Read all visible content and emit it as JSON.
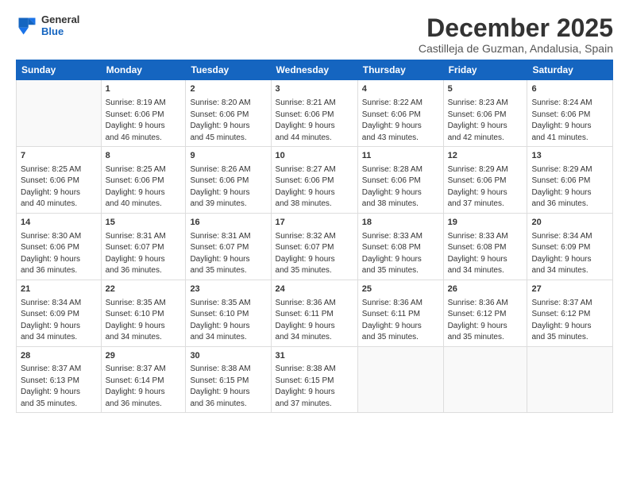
{
  "logo": {
    "line1": "General",
    "line2": "Blue"
  },
  "title": "December 2025",
  "location": "Castilleja de Guzman, Andalusia, Spain",
  "weekdays": [
    "Sunday",
    "Monday",
    "Tuesday",
    "Wednesday",
    "Thursday",
    "Friday",
    "Saturday"
  ],
  "weeks": [
    [
      {
        "day": "",
        "info": ""
      },
      {
        "day": "1",
        "info": "Sunrise: 8:19 AM\nSunset: 6:06 PM\nDaylight: 9 hours\nand 46 minutes."
      },
      {
        "day": "2",
        "info": "Sunrise: 8:20 AM\nSunset: 6:06 PM\nDaylight: 9 hours\nand 45 minutes."
      },
      {
        "day": "3",
        "info": "Sunrise: 8:21 AM\nSunset: 6:06 PM\nDaylight: 9 hours\nand 44 minutes."
      },
      {
        "day": "4",
        "info": "Sunrise: 8:22 AM\nSunset: 6:06 PM\nDaylight: 9 hours\nand 43 minutes."
      },
      {
        "day": "5",
        "info": "Sunrise: 8:23 AM\nSunset: 6:06 PM\nDaylight: 9 hours\nand 42 minutes."
      },
      {
        "day": "6",
        "info": "Sunrise: 8:24 AM\nSunset: 6:06 PM\nDaylight: 9 hours\nand 41 minutes."
      }
    ],
    [
      {
        "day": "7",
        "info": "Sunrise: 8:25 AM\nSunset: 6:06 PM\nDaylight: 9 hours\nand 40 minutes."
      },
      {
        "day": "8",
        "info": "Sunrise: 8:25 AM\nSunset: 6:06 PM\nDaylight: 9 hours\nand 40 minutes."
      },
      {
        "day": "9",
        "info": "Sunrise: 8:26 AM\nSunset: 6:06 PM\nDaylight: 9 hours\nand 39 minutes."
      },
      {
        "day": "10",
        "info": "Sunrise: 8:27 AM\nSunset: 6:06 PM\nDaylight: 9 hours\nand 38 minutes."
      },
      {
        "day": "11",
        "info": "Sunrise: 8:28 AM\nSunset: 6:06 PM\nDaylight: 9 hours\nand 38 minutes."
      },
      {
        "day": "12",
        "info": "Sunrise: 8:29 AM\nSunset: 6:06 PM\nDaylight: 9 hours\nand 37 minutes."
      },
      {
        "day": "13",
        "info": "Sunrise: 8:29 AM\nSunset: 6:06 PM\nDaylight: 9 hours\nand 36 minutes."
      }
    ],
    [
      {
        "day": "14",
        "info": "Sunrise: 8:30 AM\nSunset: 6:06 PM\nDaylight: 9 hours\nand 36 minutes."
      },
      {
        "day": "15",
        "info": "Sunrise: 8:31 AM\nSunset: 6:07 PM\nDaylight: 9 hours\nand 36 minutes."
      },
      {
        "day": "16",
        "info": "Sunrise: 8:31 AM\nSunset: 6:07 PM\nDaylight: 9 hours\nand 35 minutes."
      },
      {
        "day": "17",
        "info": "Sunrise: 8:32 AM\nSunset: 6:07 PM\nDaylight: 9 hours\nand 35 minutes."
      },
      {
        "day": "18",
        "info": "Sunrise: 8:33 AM\nSunset: 6:08 PM\nDaylight: 9 hours\nand 35 minutes."
      },
      {
        "day": "19",
        "info": "Sunrise: 8:33 AM\nSunset: 6:08 PM\nDaylight: 9 hours\nand 34 minutes."
      },
      {
        "day": "20",
        "info": "Sunrise: 8:34 AM\nSunset: 6:09 PM\nDaylight: 9 hours\nand 34 minutes."
      }
    ],
    [
      {
        "day": "21",
        "info": "Sunrise: 8:34 AM\nSunset: 6:09 PM\nDaylight: 9 hours\nand 34 minutes."
      },
      {
        "day": "22",
        "info": "Sunrise: 8:35 AM\nSunset: 6:10 PM\nDaylight: 9 hours\nand 34 minutes."
      },
      {
        "day": "23",
        "info": "Sunrise: 8:35 AM\nSunset: 6:10 PM\nDaylight: 9 hours\nand 34 minutes."
      },
      {
        "day": "24",
        "info": "Sunrise: 8:36 AM\nSunset: 6:11 PM\nDaylight: 9 hours\nand 34 minutes."
      },
      {
        "day": "25",
        "info": "Sunrise: 8:36 AM\nSunset: 6:11 PM\nDaylight: 9 hours\nand 35 minutes."
      },
      {
        "day": "26",
        "info": "Sunrise: 8:36 AM\nSunset: 6:12 PM\nDaylight: 9 hours\nand 35 minutes."
      },
      {
        "day": "27",
        "info": "Sunrise: 8:37 AM\nSunset: 6:12 PM\nDaylight: 9 hours\nand 35 minutes."
      }
    ],
    [
      {
        "day": "28",
        "info": "Sunrise: 8:37 AM\nSunset: 6:13 PM\nDaylight: 9 hours\nand 35 minutes."
      },
      {
        "day": "29",
        "info": "Sunrise: 8:37 AM\nSunset: 6:14 PM\nDaylight: 9 hours\nand 36 minutes."
      },
      {
        "day": "30",
        "info": "Sunrise: 8:38 AM\nSunset: 6:15 PM\nDaylight: 9 hours\nand 36 minutes."
      },
      {
        "day": "31",
        "info": "Sunrise: 8:38 AM\nSunset: 6:15 PM\nDaylight: 9 hours\nand 37 minutes."
      },
      {
        "day": "",
        "info": ""
      },
      {
        "day": "",
        "info": ""
      },
      {
        "day": "",
        "info": ""
      }
    ]
  ]
}
